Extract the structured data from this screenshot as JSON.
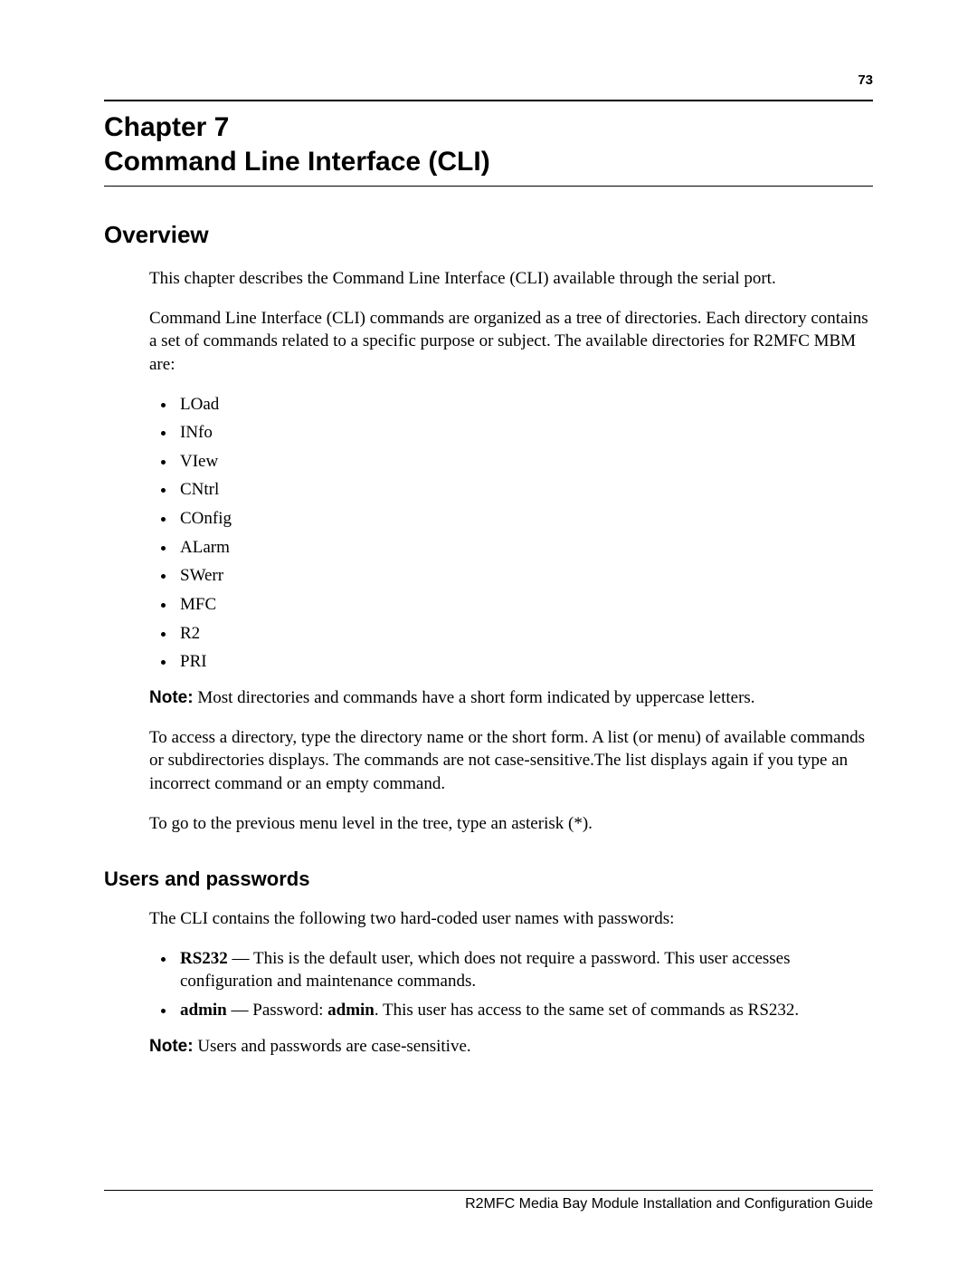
{
  "page_number": "73",
  "chapter": {
    "label": "Chapter 7",
    "title": "Command Line Interface (CLI)"
  },
  "overview": {
    "heading": "Overview",
    "p1": "This chapter describes the Command Line Interface (CLI) available through the serial port.",
    "p2": "Command Line Interface (CLI) commands are organized as a tree of directories. Each directory contains a set of commands related to a specific purpose or subject. The available directories for R2MFC MBM are:",
    "dirs": [
      "LOad",
      "INfo",
      "VIew",
      "CNtrl",
      "COnfig",
      "ALarm",
      "SWerr",
      "MFC",
      "R2",
      "PRI"
    ],
    "note_label": "Note:",
    "note_text": " Most directories and commands have a short form indicated by uppercase letters.",
    "p3": "To access a directory, type the directory name or the short form. A list (or menu) of available commands or subdirectories displays. The commands are not case-sensitive.The list displays again if you type an incorrect command or an empty command.",
    "p4": "To go to the previous menu level in the tree, type an asterisk (*)."
  },
  "users": {
    "heading": "Users and passwords",
    "p1": "The CLI contains the following two hard-coded user names with passwords:",
    "items": [
      {
        "name": "RS232",
        "sep": " — ",
        "desc": "This is the default user, which does not require a password. This user accesses configuration and maintenance commands."
      },
      {
        "name": "admin",
        "sep": " — ",
        "pre": "Password: ",
        "password": "admin",
        "desc": ". This user has access to the same set of commands as RS232."
      }
    ],
    "note_label": "Note:",
    "note_text": " Users and passwords are case-sensitive."
  },
  "footer": "R2MFC Media Bay Module Installation and Configuration Guide"
}
